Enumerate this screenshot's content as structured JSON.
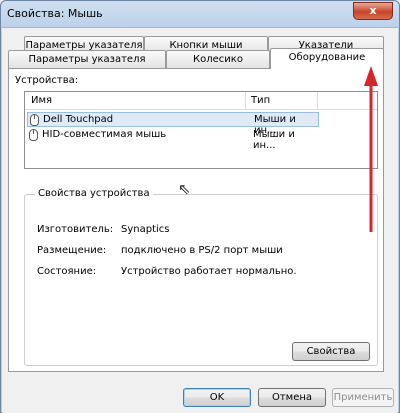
{
  "window": {
    "title": "Свойства: Мышь",
    "close_symbol": "x"
  },
  "tabs_row1": [
    {
      "label": "Параметры указателя"
    },
    {
      "label": "Кнопки мыши"
    },
    {
      "label": "Указатели"
    }
  ],
  "tabs_row2": [
    {
      "label": "Параметры указателя"
    },
    {
      "label": "Колесико"
    },
    {
      "label": "Оборудование",
      "active": true
    }
  ],
  "devices": {
    "label": "Устройства:",
    "columns": [
      "Имя",
      "Тип"
    ],
    "rows": [
      {
        "name": "Dell Touchpad",
        "type": "Мыши и ин...",
        "selected": true,
        "icon": "mouse-icon"
      },
      {
        "name": "HID-совместимая мышь",
        "type": "Мыши и ин...",
        "selected": false,
        "icon": "mouse-icon"
      }
    ]
  },
  "properties": {
    "legend": "Свойства устройства",
    "manufacturer_label": "Изготовитель:",
    "manufacturer_value": "Synaptics",
    "location_label": "Размещение:",
    "location_value": "подключено в PS/2 порт мыши",
    "status_label": "Состояние:",
    "status_value": "Устройство работает нормально.",
    "button_label": "Свойства"
  },
  "footer": {
    "ok_label": "OK",
    "cancel_label": "Отмена",
    "apply_label": "Применить"
  },
  "annotation": {
    "arrow_color": "#d6262b"
  }
}
